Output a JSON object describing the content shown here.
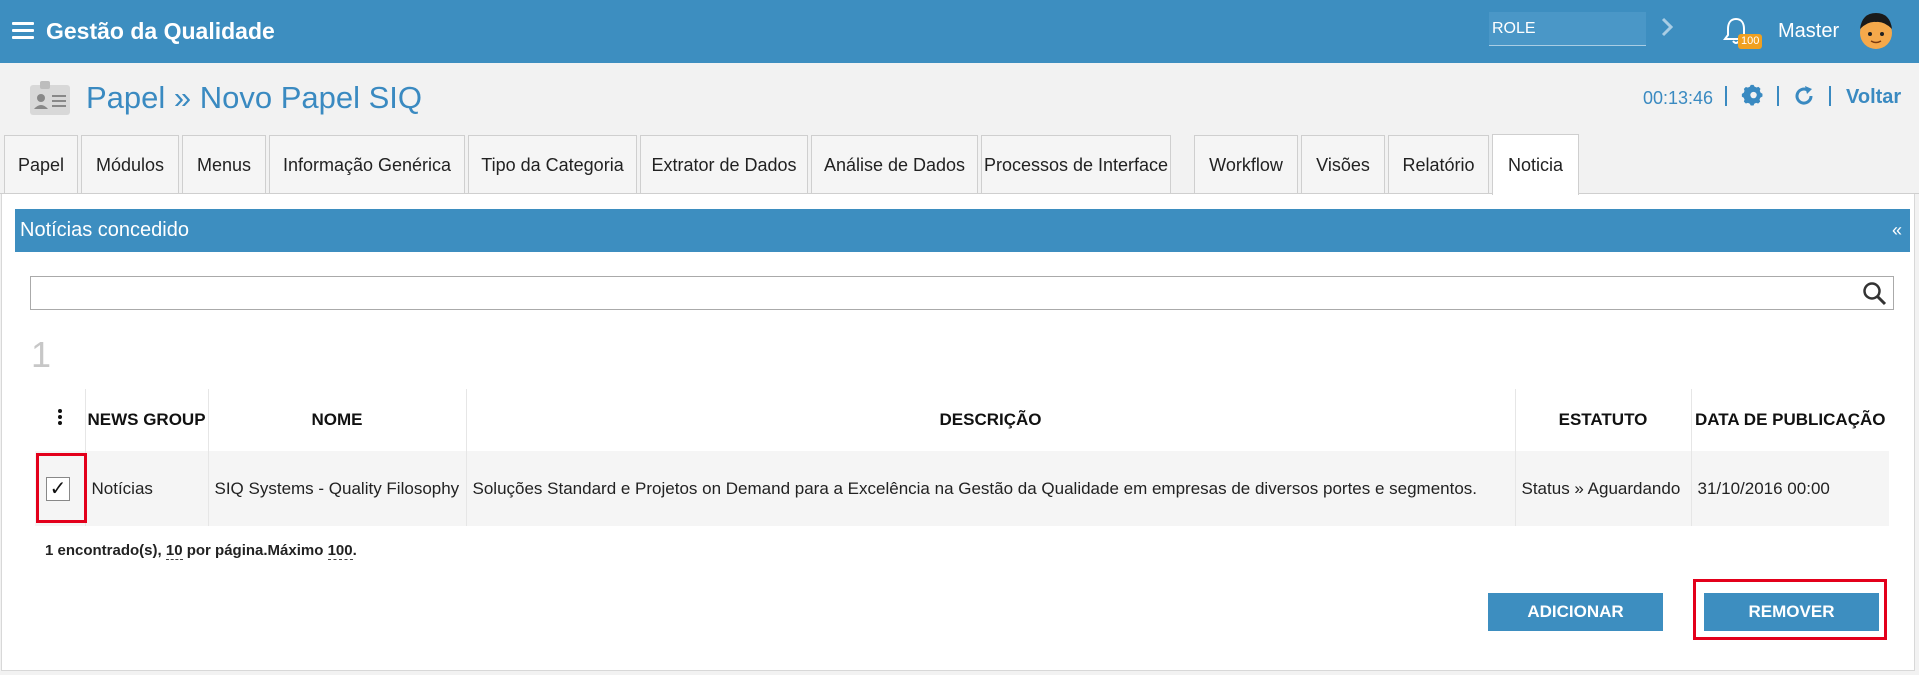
{
  "topbar": {
    "app_title": "Gestão da Qualidade",
    "role_value": "ROLE",
    "notification_count": "100",
    "user_name": "Master"
  },
  "header": {
    "title": "Papel » Novo Papel SIQ",
    "timer": "00:13:46",
    "back_label": "Voltar"
  },
  "tabs": [
    {
      "label": "Papel"
    },
    {
      "label": "Módulos"
    },
    {
      "label": "Menus"
    },
    {
      "label": "Informação Genérica"
    },
    {
      "label": "Tipo da Categoria"
    },
    {
      "label": "Extrator de Dados"
    },
    {
      "label": "Análise de Dados"
    },
    {
      "label": "Processos de Interface"
    },
    {
      "label": "Workflow"
    },
    {
      "label": "Visões"
    },
    {
      "label": "Relatório"
    },
    {
      "label": "Noticia",
      "active": true
    }
  ],
  "section": {
    "title": "Notícias concedido",
    "collapse_glyph": "«"
  },
  "search": {
    "value": "",
    "placeholder": ""
  },
  "result_count": "1",
  "table": {
    "columns": [
      "NEWS GROUP",
      "NOME",
      "DESCRIÇÃO",
      "ESTATUTO",
      "DATA DE PUBLICAÇÃO"
    ],
    "rows": [
      {
        "checked": true,
        "check_glyph": "✓",
        "news_group": "Notícias",
        "nome": "SIQ Systems - Quality Filosophy",
        "descricao": "Soluções Standard e Projetos on Demand para a Excelência na Gestão da Qualidade em empresas de diversos portes e segmentos.",
        "estatuto": "Status » Aguardando",
        "data_publicacao": "31/10/2016 00:00"
      }
    ],
    "footer": {
      "found": "1 encontrado(s),",
      "per_page_value": "10",
      "per_page_text": "por página.Máximo",
      "max_value": "100",
      "end": "."
    }
  },
  "buttons": {
    "add": "ADICIONAR",
    "remove": "REMOVER"
  },
  "colors": {
    "primary": "#3d8ec0",
    "highlight": "#e3001b",
    "badge": "#f0a020"
  }
}
